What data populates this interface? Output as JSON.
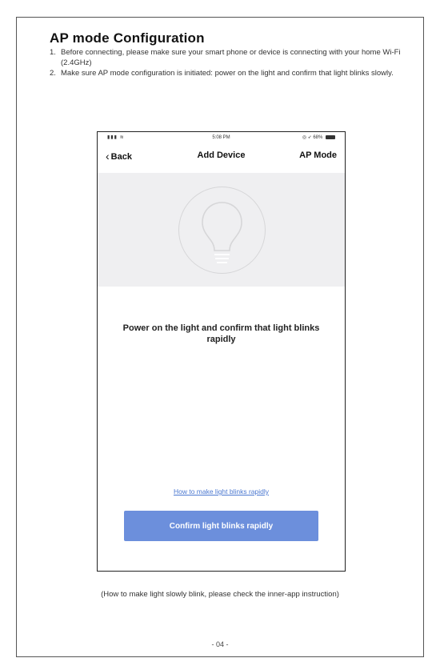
{
  "document": {
    "title": "AP mode Configuration",
    "steps": [
      {
        "num": "1.",
        "text": "Before connecting, please make sure your smart phone or device is connecting with your home Wi-Fi (2.4GHz)"
      },
      {
        "num": "2.",
        "text": "Make sure AP mode configuration is initiated: power on the light and confirm that light blinks slowly."
      }
    ],
    "note": "(How to make light slowly blink, please check the inner-app instruction)",
    "page_number": "- 04 -"
  },
  "phone": {
    "status_bar": {
      "time": "5:08 PM",
      "battery": "68%"
    },
    "nav": {
      "back_label": "Back",
      "title": "Add Device",
      "mode_label": "AP Mode"
    },
    "instruction": "Power on the light and confirm that light blinks  rapidly",
    "help_link": "How to make light blinks rapidly",
    "confirm_button": "Confirm light blinks rapidly"
  },
  "colors": {
    "accent": "#6c8fdc",
    "link": "#4a77d0",
    "hero_bg": "#efeff1"
  }
}
